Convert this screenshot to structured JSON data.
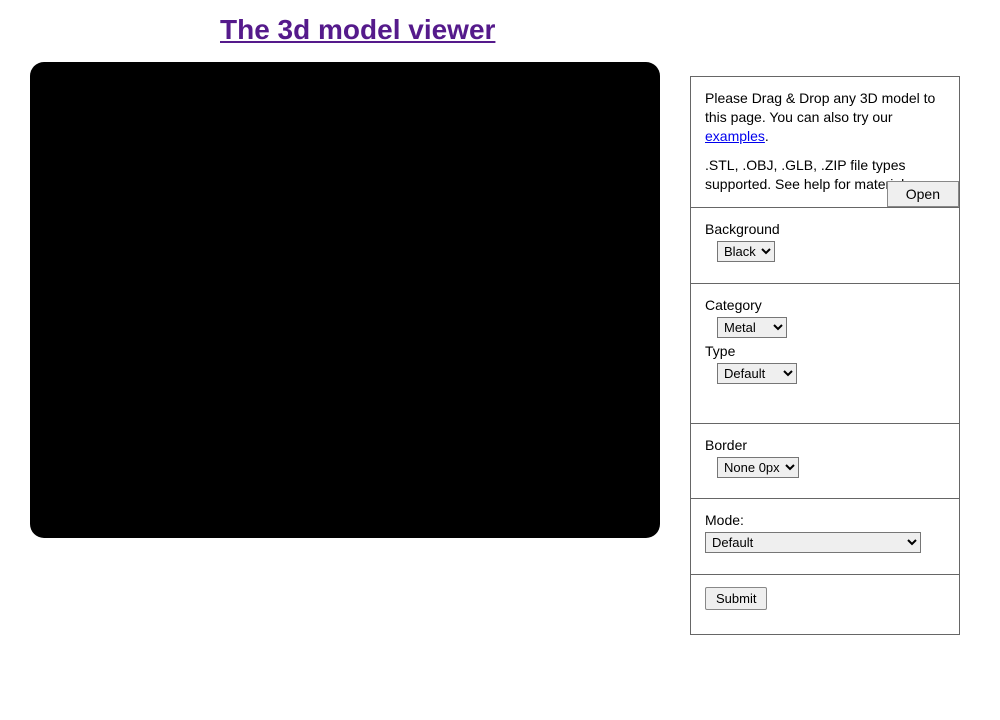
{
  "title": "The 3d model viewer",
  "intro": {
    "line1": "Please Drag & Drop any 3D model to this page. You can also try our ",
    "examples_label": "examples",
    "line1_suffix": ".",
    "line2": ".STL, .OBJ, .GLB, .ZIP file types supported. See help for materials.",
    "open_label": "Open"
  },
  "background": {
    "label": "Background",
    "value": "Black"
  },
  "category": {
    "label": "Category",
    "value": "Metal"
  },
  "type": {
    "label": "Type",
    "value": "Default"
  },
  "border": {
    "label": "Border",
    "value": "None 0px"
  },
  "mode": {
    "label": "Mode:",
    "value": "Default"
  },
  "submit_label": "Submit"
}
